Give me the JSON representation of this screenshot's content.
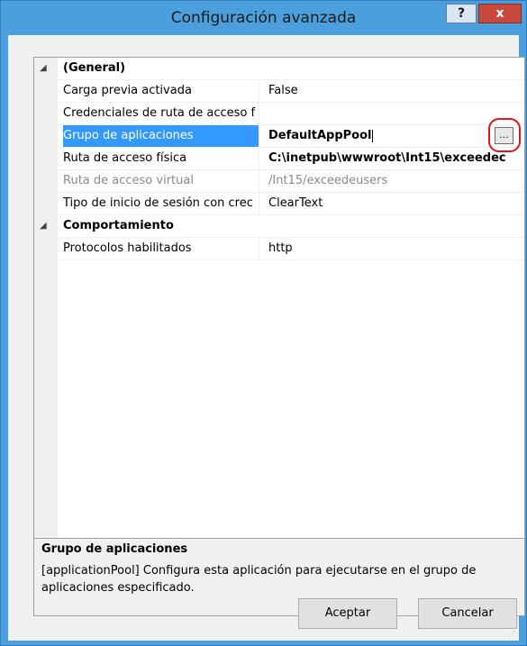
{
  "window": {
    "title": "Configuración avanzada",
    "help_label": "?",
    "close_label": "x"
  },
  "grid": {
    "categories": [
      {
        "label": "(General)",
        "expander": "◢",
        "properties": [
          {
            "name": "Carga previa activada",
            "value": "False"
          },
          {
            "name": "Credenciales de ruta de acceso f",
            "value": ""
          },
          {
            "name": "Grupo de aplicaciones",
            "value": "DefaultAppPool",
            "ellipsis": "..."
          },
          {
            "name": "Ruta de acceso física",
            "value": "C:\\inetpub\\wwwroot\\Int15\\exceedec"
          },
          {
            "name": "Ruta de acceso virtual",
            "value": "/Int15/exceedeusers"
          },
          {
            "name": "Tipo de inicio de sesión con crec",
            "value": "ClearText"
          }
        ]
      },
      {
        "label": "Comportamiento",
        "expander": "◢",
        "properties": [
          {
            "name": "Protocolos habilitados",
            "value": "http"
          }
        ]
      }
    ]
  },
  "description": {
    "title": "Grupo de aplicaciones",
    "text": "[applicationPool] Configura esta aplicación para ejecutarse en el grupo de aplicaciones especificado."
  },
  "buttons": {
    "ok": "Aceptar",
    "cancel": "Cancelar"
  },
  "colors": {
    "frame": "#4a9fdc",
    "selection": "#3399ff",
    "close": "#c9483c",
    "highlight_ring": "#e0141a"
  }
}
